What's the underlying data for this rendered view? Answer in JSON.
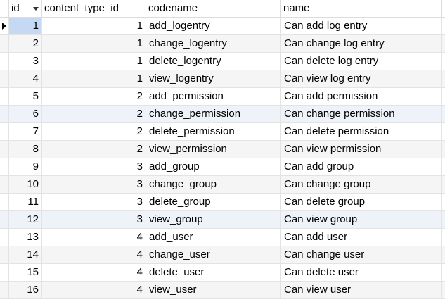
{
  "columns": {
    "id": "id",
    "content_type_id": "content_type_id",
    "codename": "codename",
    "name": "name"
  },
  "sort": {
    "column": "id",
    "direction": "descending-arrow"
  },
  "selected_row": 0,
  "rows": [
    {
      "id": "1",
      "content_type_id": "1",
      "codename": "add_logentry",
      "name": "Can add log entry"
    },
    {
      "id": "2",
      "content_type_id": "1",
      "codename": "change_logentry",
      "name": "Can change log entry"
    },
    {
      "id": "3",
      "content_type_id": "1",
      "codename": "delete_logentry",
      "name": "Can delete log entry"
    },
    {
      "id": "4",
      "content_type_id": "1",
      "codename": "view_logentry",
      "name": "Can view log entry"
    },
    {
      "id": "5",
      "content_type_id": "2",
      "codename": "add_permission",
      "name": "Can add permission"
    },
    {
      "id": "6",
      "content_type_id": "2",
      "codename": "change_permission",
      "name": "Can change permission"
    },
    {
      "id": "7",
      "content_type_id": "2",
      "codename": "delete_permission",
      "name": "Can delete permission"
    },
    {
      "id": "8",
      "content_type_id": "2",
      "codename": "view_permission",
      "name": "Can view permission"
    },
    {
      "id": "9",
      "content_type_id": "3",
      "codename": "add_group",
      "name": "Can add group"
    },
    {
      "id": "10",
      "content_type_id": "3",
      "codename": "change_group",
      "name": "Can change group"
    },
    {
      "id": "11",
      "content_type_id": "3",
      "codename": "delete_group",
      "name": "Can delete group"
    },
    {
      "id": "12",
      "content_type_id": "3",
      "codename": "view_group",
      "name": "Can view group"
    },
    {
      "id": "13",
      "content_type_id": "4",
      "codename": "add_user",
      "name": "Can add user"
    },
    {
      "id": "14",
      "content_type_id": "4",
      "codename": "change_user",
      "name": "Can change user"
    },
    {
      "id": "15",
      "content_type_id": "4",
      "codename": "delete_user",
      "name": "Can delete user"
    },
    {
      "id": "16",
      "content_type_id": "4",
      "codename": "view_user",
      "name": "Can view user"
    }
  ]
}
